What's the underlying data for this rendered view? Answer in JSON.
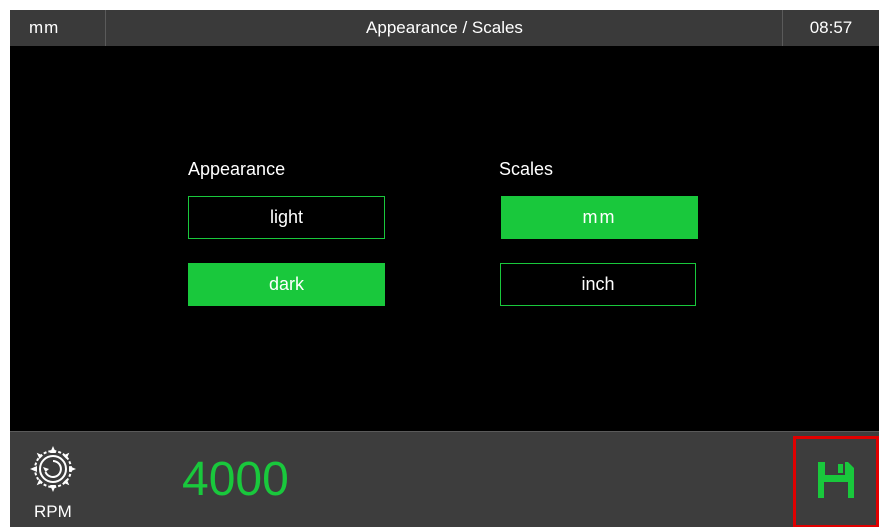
{
  "header": {
    "unit": "mm",
    "title": "Appearance / Scales",
    "time": "08:57"
  },
  "appearance": {
    "label": "Appearance",
    "options": [
      {
        "label": "light",
        "selected": false
      },
      {
        "label": "dark",
        "selected": true
      }
    ]
  },
  "scales": {
    "label": "Scales",
    "options": [
      {
        "label": "mm",
        "selected": true
      },
      {
        "label": "inch",
        "selected": false
      }
    ]
  },
  "footer": {
    "rpm_label": "RPM",
    "rpm_value": "4000",
    "save_icon": "floppy-disk-icon",
    "rpm_icon": "saw-blade-icon"
  },
  "colors": {
    "accent": "#19c83c",
    "background": "#000000",
    "bar": "#3a3a3a",
    "highlight": "#e00000"
  }
}
